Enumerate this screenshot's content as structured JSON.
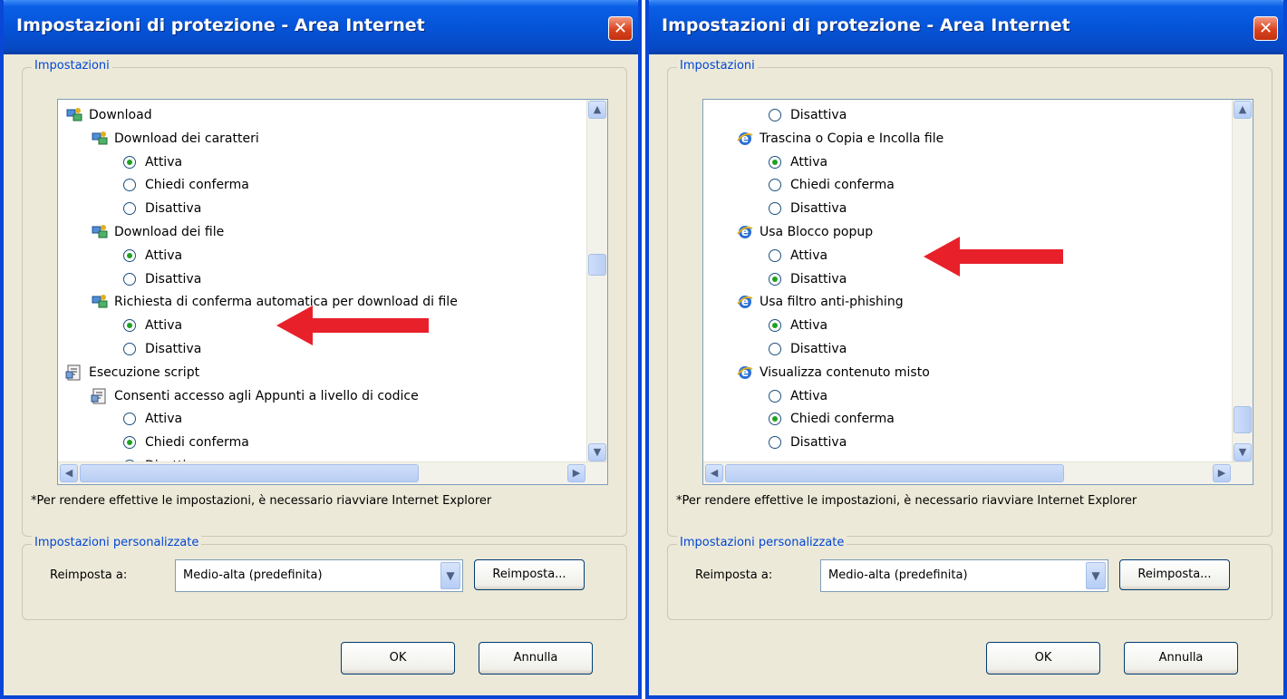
{
  "dialogs": [
    {
      "title": "Impostazioni di protezione - Area Internet",
      "settings_group_label": "Impostazioni",
      "tree": [
        {
          "type": "category",
          "icon": "network-icon",
          "label": "Download",
          "indent": 0
        },
        {
          "type": "option",
          "icon": "network-icon",
          "label": "Download dei caratteri",
          "indent": 1
        },
        {
          "type": "radio",
          "label": "Attiva",
          "checked": true,
          "indent": 2
        },
        {
          "type": "radio",
          "label": "Chiedi conferma",
          "checked": false,
          "indent": 2
        },
        {
          "type": "radio",
          "label": "Disattiva",
          "checked": false,
          "indent": 2
        },
        {
          "type": "option",
          "icon": "network-icon",
          "label": "Download dei file",
          "indent": 1
        },
        {
          "type": "radio",
          "label": "Attiva",
          "checked": true,
          "indent": 2
        },
        {
          "type": "radio",
          "label": "Disattiva",
          "checked": false,
          "indent": 2
        },
        {
          "type": "option",
          "icon": "network-icon",
          "label": "Richiesta di conferma automatica per download di file",
          "indent": 1
        },
        {
          "type": "radio",
          "label": "Attiva",
          "checked": true,
          "indent": 2
        },
        {
          "type": "radio",
          "label": "Disattiva",
          "checked": false,
          "indent": 2
        },
        {
          "type": "category",
          "icon": "script-icon",
          "label": "Esecuzione script",
          "indent": 0
        },
        {
          "type": "option",
          "icon": "script-icon",
          "label": "Consenti accesso agli Appunti a livello di codice",
          "indent": 1
        },
        {
          "type": "radio",
          "label": "Attiva",
          "checked": false,
          "indent": 2
        },
        {
          "type": "radio",
          "label": "Chiedi conferma",
          "checked": true,
          "indent": 2
        },
        {
          "type": "radio",
          "label": "Disattiva",
          "checked": false,
          "indent": 2
        }
      ],
      "note": "*Per rendere effettive le impostazioni, è necessario riavviare Internet Explorer",
      "custom_group_label": "Impostazioni personalizzate",
      "reset_label": "Reimposta a:",
      "reset_select_value": "Medio-alta (predefinita)",
      "reset_button": "Reimposta...",
      "ok_button": "OK",
      "cancel_button": "Annulla",
      "annotation_color": "#e8202a"
    },
    {
      "title": "Impostazioni di protezione - Area Internet",
      "settings_group_label": "Impostazioni",
      "tree": [
        {
          "type": "radio",
          "label": "Disattiva",
          "checked": false,
          "indent": 2
        },
        {
          "type": "option",
          "icon": "ie-icon",
          "label": "Trascina o Copia e Incolla file",
          "indent": 1
        },
        {
          "type": "radio",
          "label": "Attiva",
          "checked": true,
          "indent": 2
        },
        {
          "type": "radio",
          "label": "Chiedi conferma",
          "checked": false,
          "indent": 2
        },
        {
          "type": "radio",
          "label": "Disattiva",
          "checked": false,
          "indent": 2
        },
        {
          "type": "option",
          "icon": "ie-icon",
          "label": "Usa Blocco popup",
          "indent": 1
        },
        {
          "type": "radio",
          "label": "Attiva",
          "checked": false,
          "indent": 2
        },
        {
          "type": "radio",
          "label": "Disattiva",
          "checked": true,
          "indent": 2
        },
        {
          "type": "option",
          "icon": "ie-icon",
          "label": "Usa filtro anti-phishing",
          "indent": 1
        },
        {
          "type": "radio",
          "label": "Attiva",
          "checked": true,
          "indent": 2
        },
        {
          "type": "radio",
          "label": "Disattiva",
          "checked": false,
          "indent": 2
        },
        {
          "type": "option",
          "icon": "ie-icon",
          "label": "Visualizza contenuto misto",
          "indent": 1
        },
        {
          "type": "radio",
          "label": "Attiva",
          "checked": false,
          "indent": 2
        },
        {
          "type": "radio",
          "label": "Chiedi conferma",
          "checked": true,
          "indent": 2
        },
        {
          "type": "radio",
          "label": "Disattiva",
          "checked": false,
          "indent": 2
        }
      ],
      "note": "*Per rendere effettive le impostazioni, è necessario riavviare Internet Explorer",
      "custom_group_label": "Impostazioni personalizzate",
      "reset_label": "Reimposta a:",
      "reset_select_value": "Medio-alta (predefinita)",
      "reset_button": "Reimposta...",
      "ok_button": "OK",
      "cancel_button": "Annulla",
      "annotation_color": "#e8202a"
    }
  ]
}
